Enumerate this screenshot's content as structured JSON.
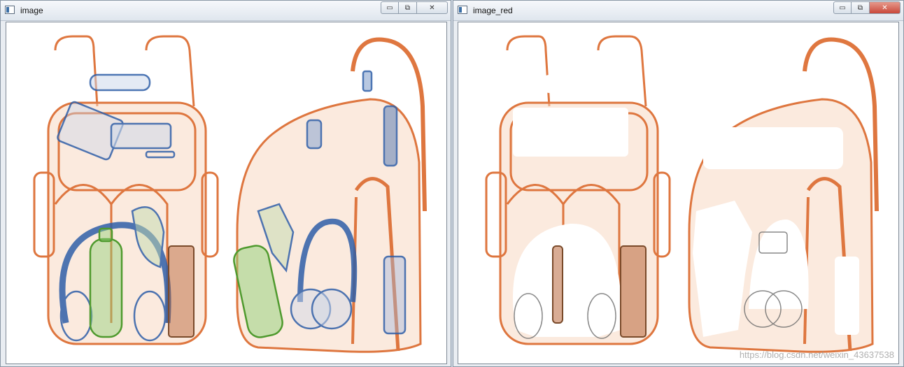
{
  "windows": [
    {
      "title": "image",
      "controls": {
        "minimize": "▭",
        "restore": "⧉",
        "close": "✕"
      },
      "icon": "window-app-icon"
    },
    {
      "title": "image_red",
      "controls": {
        "minimize": "▭",
        "restore": "⧉",
        "close": "✕"
      },
      "icon": "window-app-icon"
    }
  ],
  "watermark": "https://blog.csdn.net/weixin_43637538",
  "colors": {
    "bag_orange": "#d95f1e",
    "item_blue": "#2f5fa8",
    "bottle_green": "#4f9a2e",
    "accent_close": "#c9483a"
  }
}
